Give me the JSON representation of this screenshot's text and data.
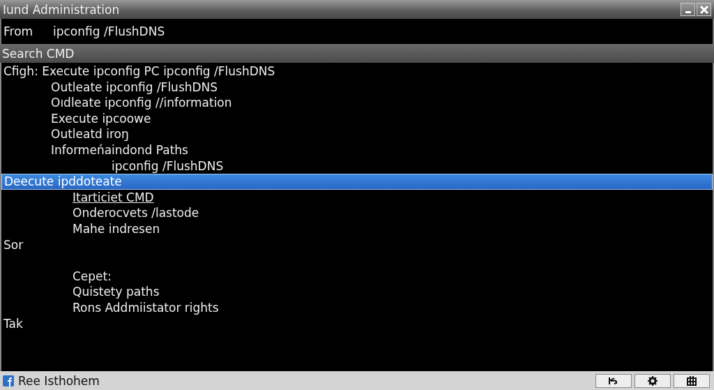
{
  "window": {
    "title": "Iund Administration"
  },
  "command_field": {
    "label": "From",
    "value": "ipconfig /FlushDNS"
  },
  "search_bar": {
    "label": "Search CMD"
  },
  "console_lines": [
    {
      "text": "Cfigh: Execute ipconfig PC ipconfig /FlushDNS",
      "kind": "plain",
      "selected": false,
      "underlined": false
    },
    {
      "text": "Outleate ipconfig /FlushDNS",
      "kind": "indent",
      "selected": false,
      "underlined": false
    },
    {
      "text": "Oıdleate ipconfig  //information",
      "kind": "indent",
      "selected": false,
      "underlined": false
    },
    {
      "text": "Execute ipcoowe",
      "kind": "indent",
      "selected": false,
      "underlined": false
    },
    {
      "text": "Outleatd iroŋ",
      "kind": "indent",
      "selected": false,
      "underlined": false
    },
    {
      "text": "Informeńaindond  Paths",
      "kind": "indent",
      "selected": false,
      "underlined": false
    },
    {
      "text": "ipconfig /FlushDNS",
      "kind": "deep",
      "selected": false,
      "underlined": false
    },
    {
      "text": "Deecute ipddoteate",
      "kind": "plain",
      "selected": true,
      "underlined": false
    },
    {
      "text": "Itarticiet CMD",
      "kind": "wide",
      "selected": false,
      "underlined": true
    },
    {
      "text": "Onderocvets /lastode",
      "kind": "wide",
      "selected": false,
      "underlined": false
    },
    {
      "text": "Mahe indresen",
      "kind": "wide",
      "selected": false,
      "underlined": false
    },
    {
      "text": "Sor",
      "kind": "plain",
      "selected": false,
      "underlined": false
    },
    {
      "text": "Cepet:",
      "kind": "wide-spaced",
      "selected": false,
      "underlined": false
    },
    {
      "text": "Quistety paths",
      "kind": "wide",
      "selected": false,
      "underlined": false
    },
    {
      "text": "Rons Addmiistator rights",
      "kind": "wide",
      "selected": false,
      "underlined": false
    },
    {
      "text": "Tak",
      "kind": "plain",
      "selected": false,
      "underlined": false
    }
  ],
  "status_bar": {
    "text": "Ree Isthohem"
  }
}
